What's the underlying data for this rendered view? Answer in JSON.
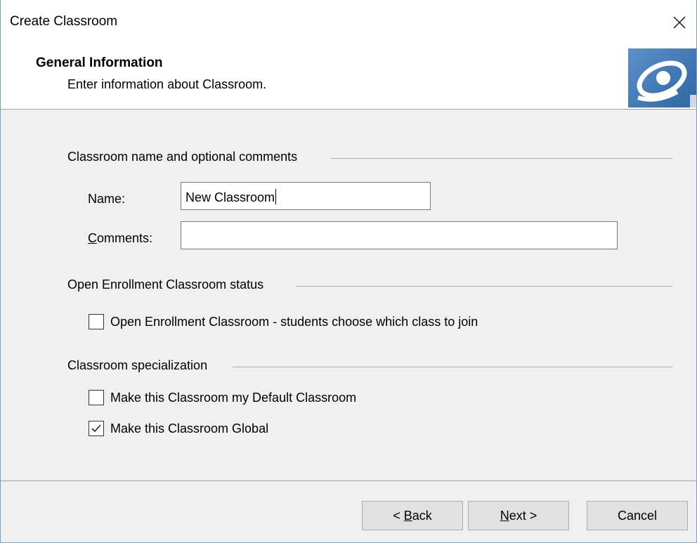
{
  "window": {
    "title": "Create Classroom"
  },
  "header": {
    "title": "General Information",
    "subtitle": "Enter information about Classroom."
  },
  "groups": {
    "name_comments": "Classroom name and optional comments",
    "open_enrollment": "Open Enrollment Classroom status",
    "specialization": "Classroom specialization"
  },
  "fields": {
    "name_label": "Name:",
    "name_value": "New Classroom",
    "comments_label_accel": "C",
    "comments_label_rest": "omments:",
    "comments_value": ""
  },
  "checkboxes": {
    "open_enrollment": {
      "label": "Open Enrollment Classroom - students choose which class to join",
      "checked": false
    },
    "default_classroom": {
      "label": "Make this Classroom my Default Classroom",
      "checked": false
    },
    "global_classroom": {
      "label": "Make this Classroom Global",
      "checked": true
    }
  },
  "buttons": {
    "back_prefix": "< ",
    "back_accel": "B",
    "back_rest": "ack",
    "next_accel": "N",
    "next_rest": "ext >",
    "cancel": "Cancel"
  },
  "icons": {
    "close": "close-icon",
    "logo": "eye-logo-icon",
    "check": "checkmark-icon"
  },
  "colors": {
    "logo_blue": "#3f77b4",
    "dialog_bg": "#f0f0f0",
    "header_bg": "#ffffff"
  }
}
